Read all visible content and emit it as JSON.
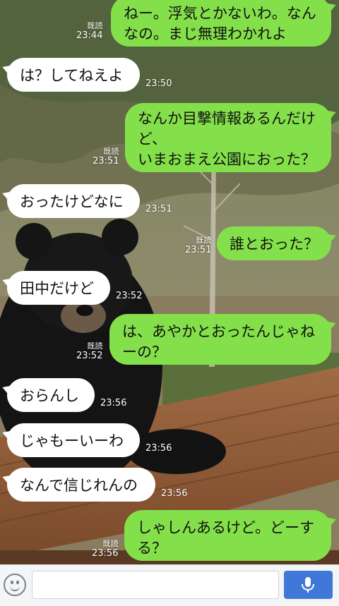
{
  "messages": [
    {
      "side": "sent",
      "text": "ねー。浮気とかないわ。なん\nなの。まじ無理わかれよ",
      "read": "既読",
      "time": "23:44"
    },
    {
      "side": "recv",
      "text": "は？してねえよ",
      "time": "23:50"
    },
    {
      "side": "sent",
      "text": "なんか目撃情報あるんだけ\nど、\nいまおまえ公園におった？",
      "read": "既読",
      "time": "23:51"
    },
    {
      "side": "recv",
      "text": "おったけどなに",
      "time": "23:51"
    },
    {
      "side": "sent",
      "text": "誰とおった？",
      "read": "既読",
      "time": "23:51"
    },
    {
      "side": "recv",
      "text": "田中だけど",
      "time": "23:52"
    },
    {
      "side": "sent",
      "text": "は、あやかとおったんじゃね\nーの？",
      "read": "既読",
      "time": "23:52"
    },
    {
      "side": "recv",
      "text": "おらんし",
      "time": "23:56"
    },
    {
      "side": "recv",
      "text": "じゃもーいーわ",
      "time": "23:56"
    },
    {
      "side": "recv",
      "text": "なんで信じれんの",
      "time": "23:56"
    },
    {
      "side": "sent",
      "text": "しゃしんあるけど。どーす\nる？",
      "read": "既読",
      "time": "23:56"
    }
  ],
  "input": {
    "placeholder": ""
  },
  "icons": {
    "emoji": "smiley-icon",
    "mic": "microphone-icon"
  },
  "colors": {
    "sent_bubble": "#84e04a",
    "recv_bubble": "#ffffff",
    "mic_button": "#3f78d8"
  }
}
